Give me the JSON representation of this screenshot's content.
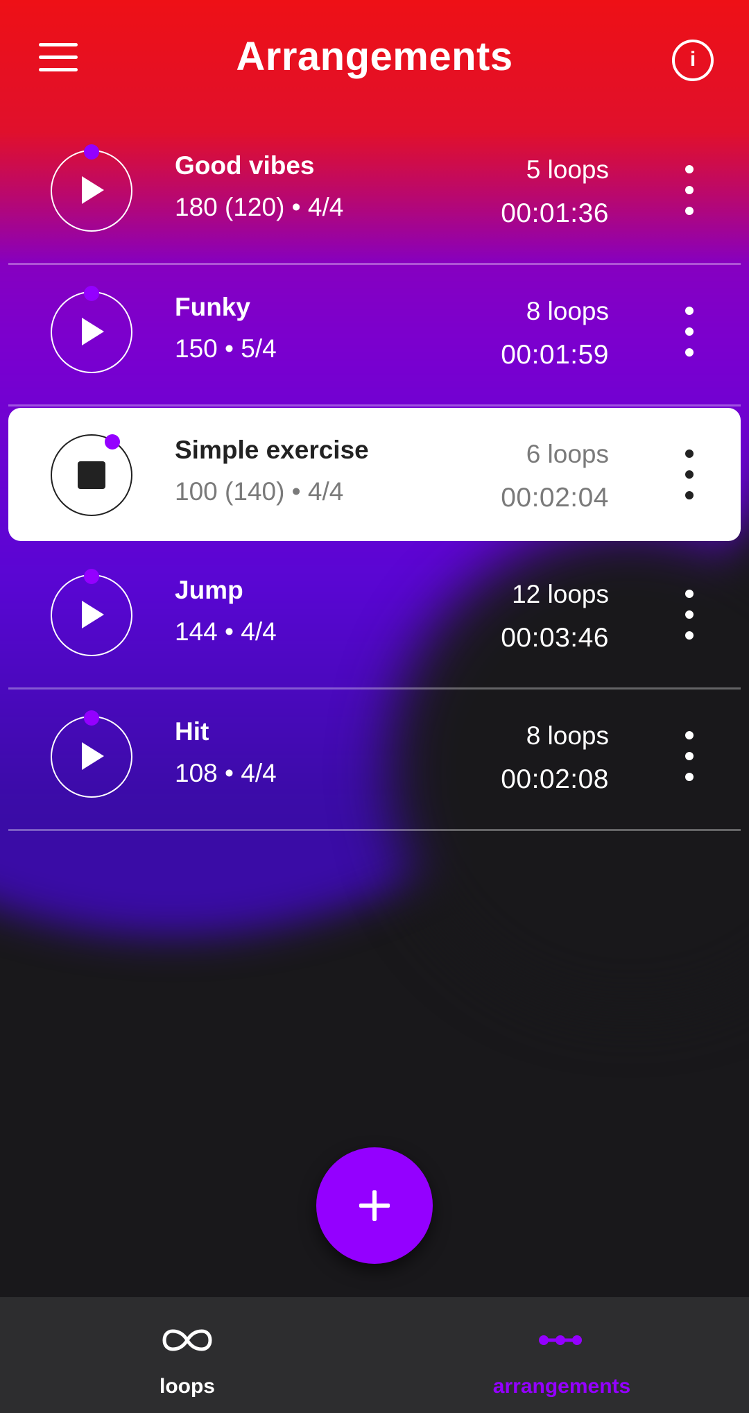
{
  "header": {
    "title": "Arrangements",
    "menu_icon": "hamburger-menu-icon",
    "info_icon": "info-icon",
    "info_glyph": "i"
  },
  "arrangements": [
    {
      "name": "Good vibes",
      "meta": "180 (120) • 4/4",
      "loops": "5 loops",
      "duration": "00:01:36",
      "state": "stopped"
    },
    {
      "name": "Funky",
      "meta": "150 • 5/4",
      "loops": "8 loops",
      "duration": "00:01:59",
      "state": "stopped"
    },
    {
      "name": "Simple exercise",
      "meta": "100 (140) • 4/4",
      "loops": "6 loops",
      "duration": "00:02:04",
      "state": "playing"
    },
    {
      "name": "Jump",
      "meta": "144 • 4/4",
      "loops": "12 loops",
      "duration": "00:03:46",
      "state": "stopped"
    },
    {
      "name": "Hit",
      "meta": "108 • 4/4",
      "loops": "8 loops",
      "duration": "00:02:08",
      "state": "stopped"
    }
  ],
  "fab": {
    "icon": "plus-icon"
  },
  "bottom_nav": {
    "items": [
      {
        "label": "loops",
        "icon": "infinity-icon",
        "active": false
      },
      {
        "label": "arrangements",
        "icon": "arrangement-dots-icon",
        "active": true
      }
    ]
  },
  "colors": {
    "accent": "#9400ff",
    "header_red": "#ee1016",
    "background": "#19181b",
    "nav_background": "#2d2d2f"
  }
}
